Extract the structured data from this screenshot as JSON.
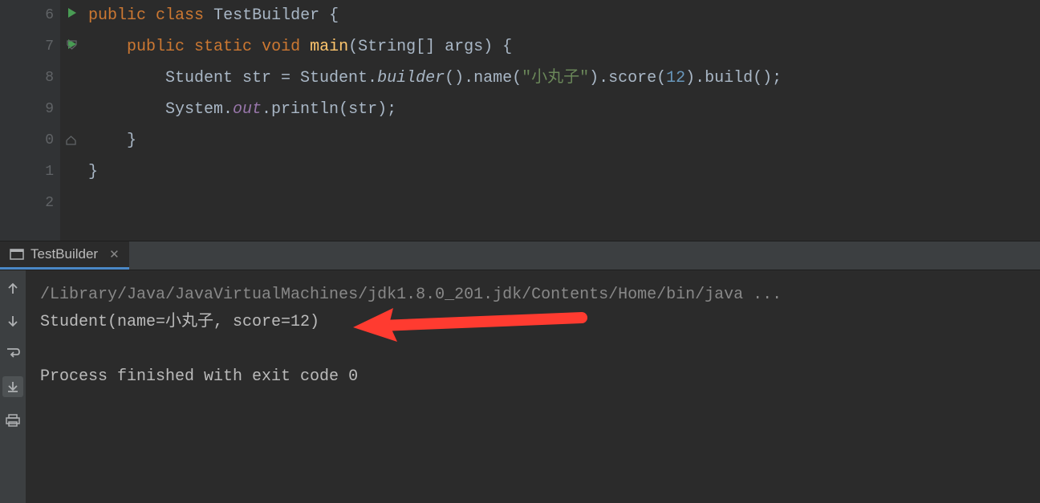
{
  "gutter": {
    "lines": [
      "6",
      "7",
      "8",
      "9",
      "0",
      "1",
      "2"
    ]
  },
  "code": {
    "line6": {
      "kw1": "public",
      "kw2": "class",
      "name": "TestBuilder",
      "brace": " {"
    },
    "line7": {
      "kw1": "public",
      "kw2": "static",
      "kw3": "void",
      "fn": "main",
      "params": "(String[] args) {"
    },
    "line8": {
      "type": "Student str = Student.",
      "builder": "builder",
      "p1": "().name(",
      "str": "\"小丸子\"",
      "p2": ").score(",
      "num": "12",
      "p3": ").build();"
    },
    "line9": {
      "p1": "System.",
      "out": "out",
      "p2": ".println(str);"
    },
    "line10": "    }",
    "line11": "}"
  },
  "console": {
    "tab_name": "TestBuilder",
    "cmd": "/Library/Java/JavaVirtualMachines/jdk1.8.0_201.jdk/Contents/Home/bin/java ...",
    "output": "Student(name=小丸子, score=12)",
    "exit": "Process finished with exit code 0"
  }
}
